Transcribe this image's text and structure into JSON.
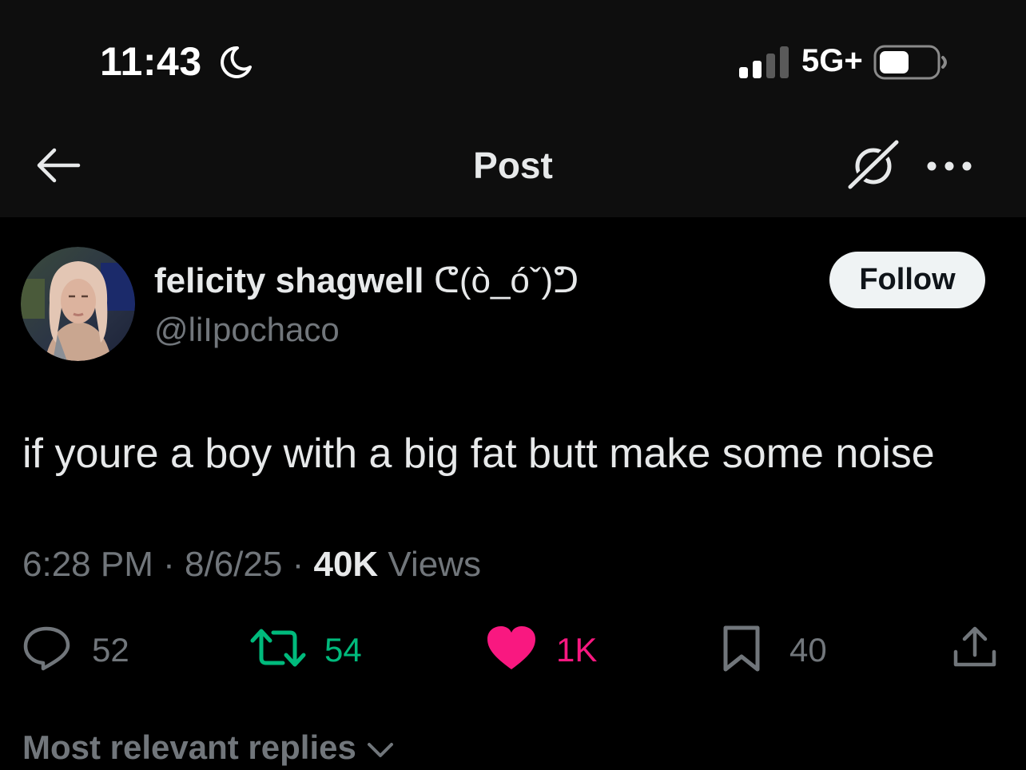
{
  "status_bar": {
    "time": "11:43",
    "network": "5G+",
    "icons": [
      "moon-icon",
      "signal-icon",
      "battery-icon"
    ]
  },
  "header": {
    "title": "Post",
    "icons": [
      "back-arrow-icon",
      "grok-icon",
      "more-icon"
    ]
  },
  "author": {
    "display_name": "felicity shagwell",
    "display_name_suffix": "ᕦ(ò_óˇ)ᕤ",
    "handle": "@liIpochaco",
    "follow_label": "Follow"
  },
  "post": {
    "text": "if youre a boy with a big fat butt make some noise",
    "time": "6:28 PM",
    "date": "8/6/25",
    "views_count": "40K",
    "views_label": "Views",
    "separator": "·"
  },
  "actions": {
    "replies": "52",
    "reposts": "54",
    "likes": "1K",
    "bookmarks": "40"
  },
  "replies_sort": {
    "label": "Most relevant replies"
  },
  "colors": {
    "background": "#000000",
    "header_bg": "#0e0e0e",
    "text_primary": "#e7e9ea",
    "text_secondary": "#71767b",
    "repost_green": "#00ba7c",
    "like_pink": "#f91880",
    "follow_bg": "#eff3f4"
  }
}
